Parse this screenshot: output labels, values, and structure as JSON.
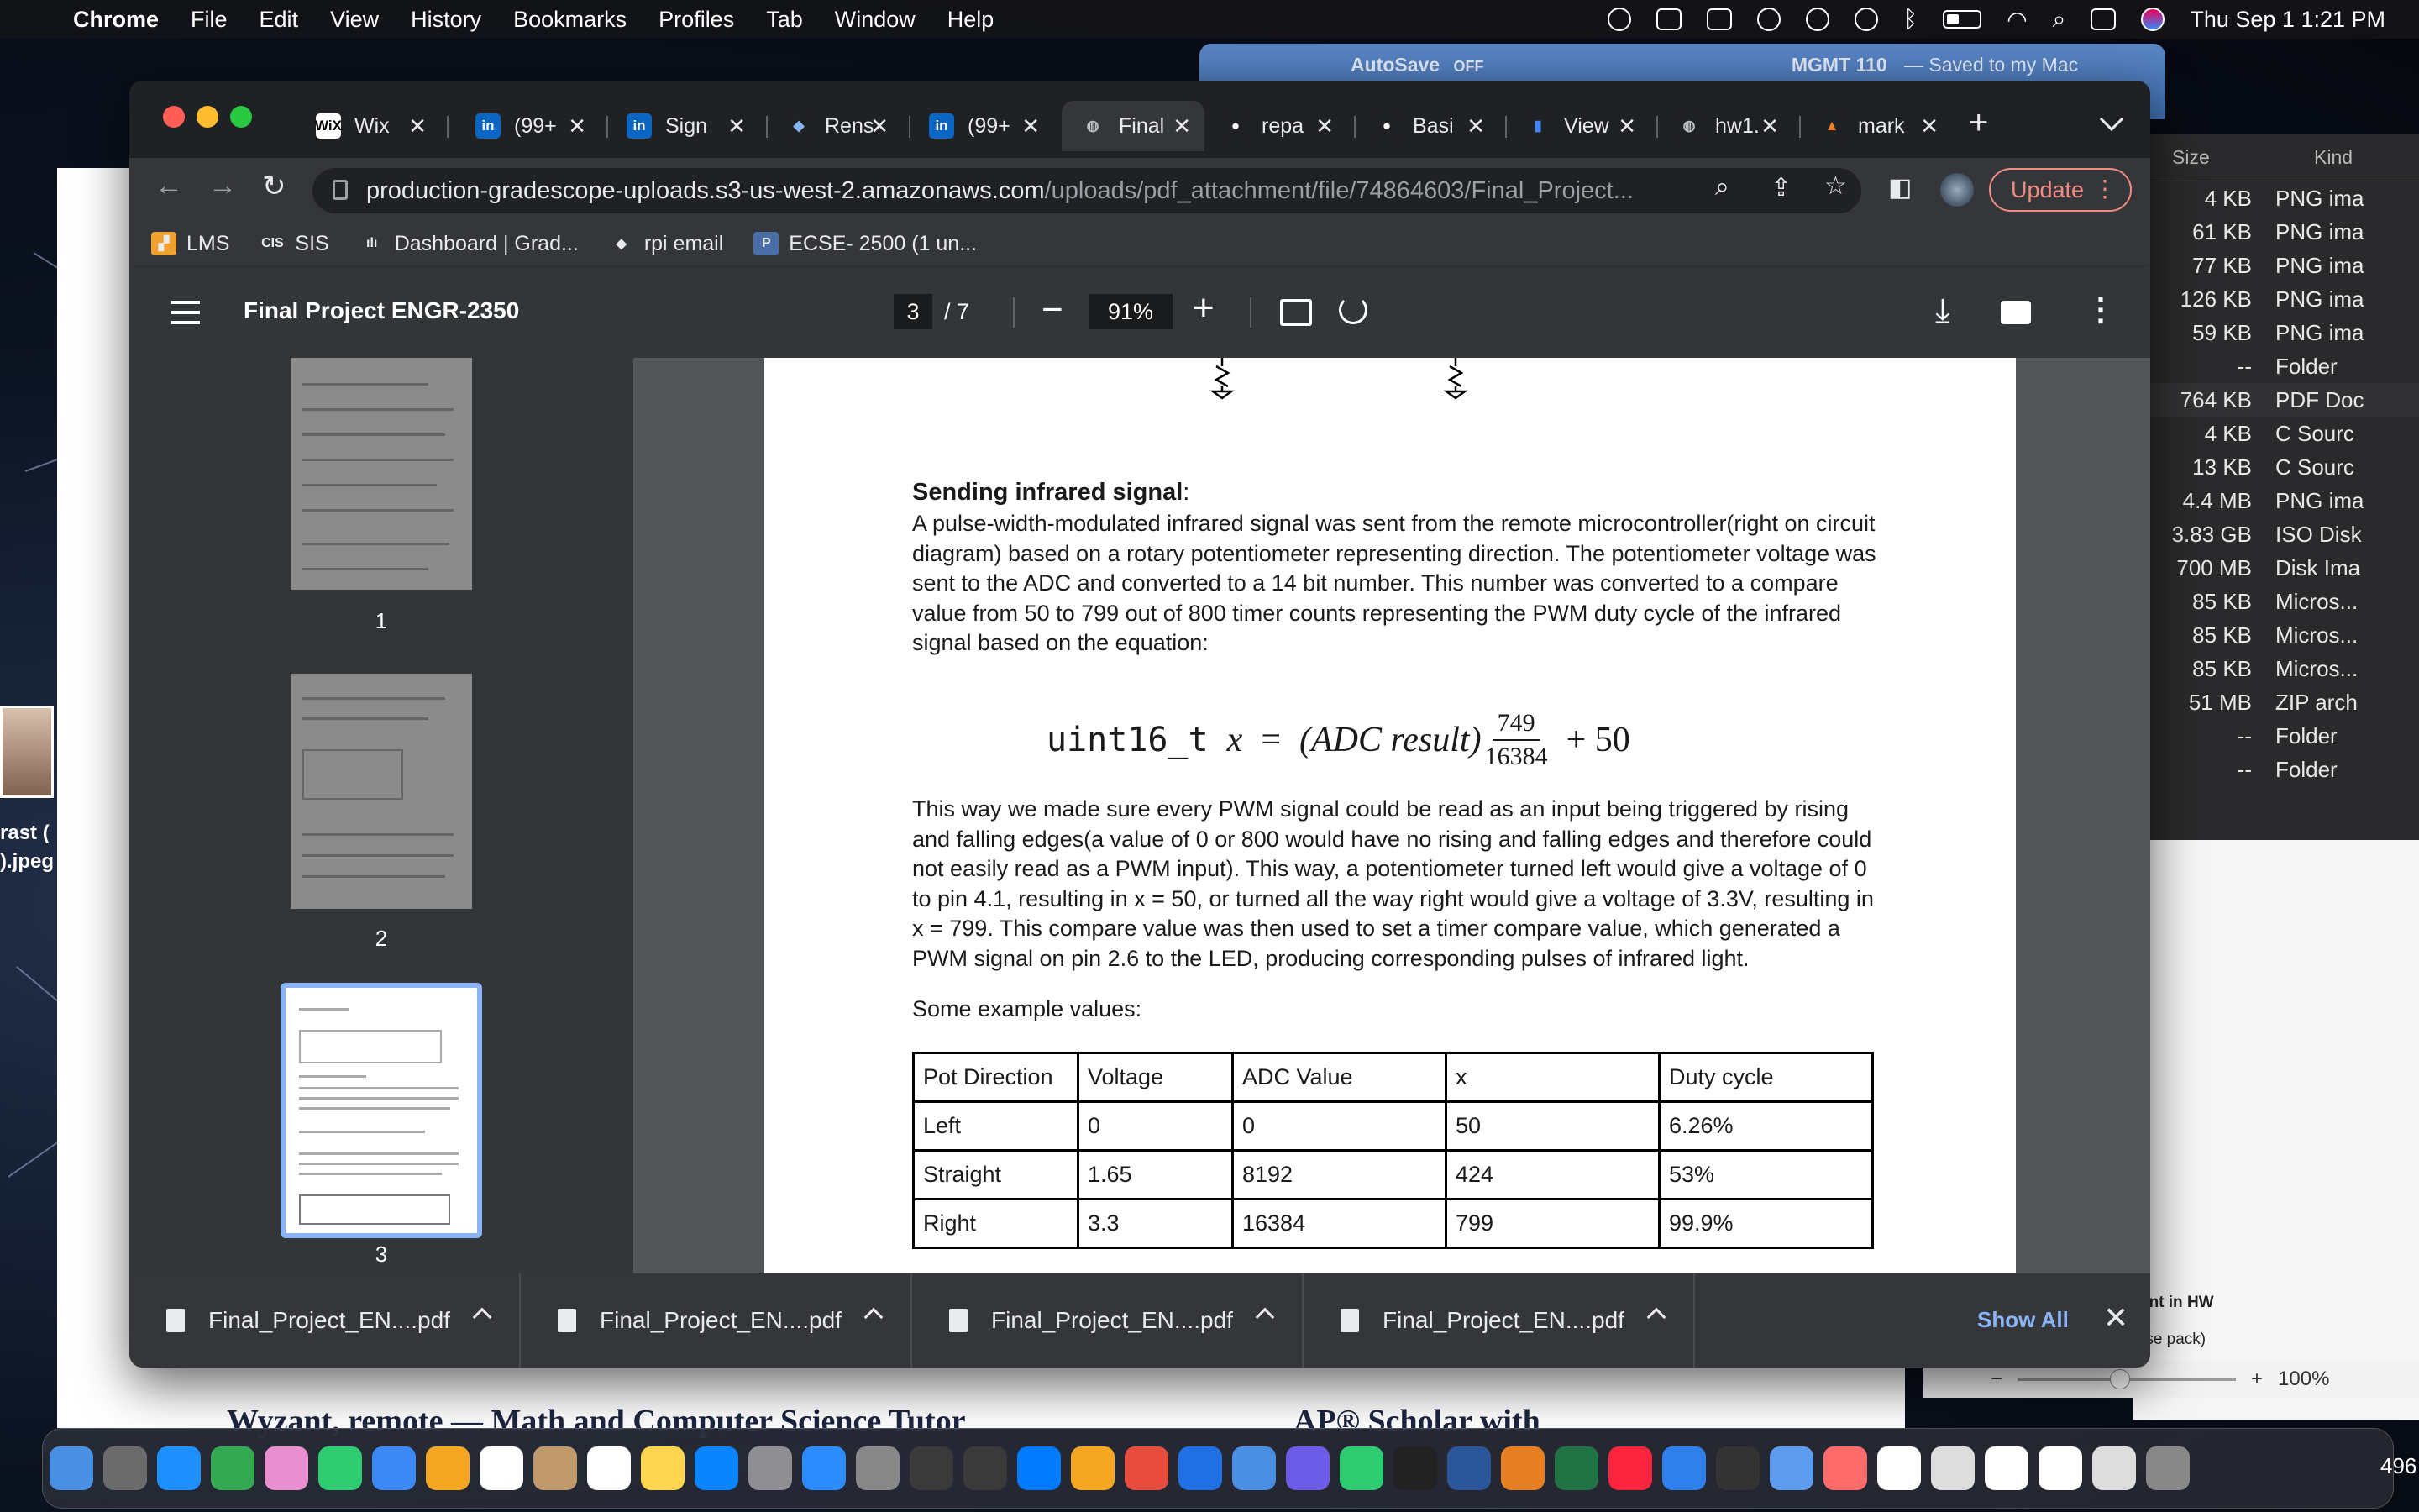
{
  "menubar": {
    "app": "Chrome",
    "items": [
      "File",
      "Edit",
      "View",
      "History",
      "Bookmarks",
      "Profiles",
      "Tab",
      "Window",
      "Help"
    ],
    "clock": "Thu Sep 1  1:21 PM"
  },
  "background": {
    "word_title": "AutoSave",
    "word_toggle": "OFF",
    "word_doc": "MGMT 110",
    "word_saved": "— Saved to my Mac",
    "desktop_file_label_1": "rast (",
    "desktop_file_label_2": ").jpeg",
    "doc_heading_left": "Wyzant, remote — Math and Computer Science Tutor",
    "doc_heading_right": "AP® Scholar with",
    "panel_text_1": "ent in HW",
    "panel_text_2": "rse pack)",
    "zoom_value": "100%",
    "dock_trailing": "496"
  },
  "finder": {
    "col_size": "Size",
    "col_kind": "Kind",
    "rows": [
      {
        "size": "4 KB",
        "kind": "PNG ima"
      },
      {
        "size": "61 KB",
        "kind": "PNG ima"
      },
      {
        "size": "77 KB",
        "kind": "PNG ima"
      },
      {
        "size": "126 KB",
        "kind": "PNG ima"
      },
      {
        "size": "59 KB",
        "kind": "PNG ima"
      },
      {
        "size": "--",
        "kind": "Folder"
      },
      {
        "size": "764 KB",
        "kind": "PDF Doc"
      },
      {
        "size": "4 KB",
        "kind": "C Sourc"
      },
      {
        "size": "13 KB",
        "kind": "C Sourc"
      },
      {
        "size": "4.4 MB",
        "kind": "PNG ima"
      },
      {
        "size": "3.83 GB",
        "kind": "ISO Disk"
      },
      {
        "size": "700 MB",
        "kind": "Disk Ima"
      },
      {
        "size": "85 KB",
        "kind": "Micros..."
      },
      {
        "size": "85 KB",
        "kind": "Micros..."
      },
      {
        "size": "85 KB",
        "kind": "Micros..."
      },
      {
        "size": "51 MB",
        "kind": "ZIP arch"
      },
      {
        "size": "--",
        "kind": "Folder"
      },
      {
        "size": "--",
        "kind": "Folder"
      }
    ]
  },
  "tabs": [
    {
      "label": "Wix",
      "fav": "WiX",
      "color": "#ffffff",
      "fg": "#000000"
    },
    {
      "label": "(99+",
      "fav": "in",
      "color": "#0a66c2",
      "fg": "#ffffff"
    },
    {
      "label": "Sign",
      "fav": "in",
      "color": "#0a66c2",
      "fg": "#ffffff"
    },
    {
      "label": "Rens",
      "fav": "◆",
      "color": "#202124",
      "fg": "#8ab4f8"
    },
    {
      "label": "(99+",
      "fav": "in",
      "color": "#0a66c2",
      "fg": "#ffffff"
    },
    {
      "label": "Final",
      "fav": "◍",
      "color": "#35363a",
      "fg": "#bdc1c6"
    },
    {
      "label": "repa",
      "fav": "●",
      "color": "#202124",
      "fg": "#ffffff"
    },
    {
      "label": "Basi",
      "fav": "●",
      "color": "#202124",
      "fg": "#ffffff"
    },
    {
      "label": "View",
      "fav": "▮",
      "color": "#202124",
      "fg": "#4285f4"
    },
    {
      "label": "hw1.",
      "fav": "◍",
      "color": "#202124",
      "fg": "#bdc1c6"
    },
    {
      "label": "mark",
      "fav": "▲",
      "color": "#202124",
      "fg": "#f6821f"
    }
  ],
  "omnibox": {
    "host": "production-gradescope-uploads.s3-us-west-2.amazonaws.com",
    "path": "/uploads/pdf_attachment/file/74864603/Final_Project...",
    "update_label": "Update"
  },
  "bookmarks": [
    {
      "label": "LMS",
      "fav": "▞",
      "bg": "#f0a030"
    },
    {
      "label": "SIS",
      "fav": "CIS",
      "bg": "#35363a"
    },
    {
      "label": "Dashboard | Grad...",
      "fav": "ılı",
      "bg": "#35363a"
    },
    {
      "label": "rpi email",
      "fav": "◆",
      "bg": "#35363a"
    },
    {
      "label": "ECSE- 2500 (1 un...",
      "fav": "P",
      "bg": "#4a6fa5"
    }
  ],
  "pdf": {
    "title": "Final Project ENGR-2350",
    "page_current": "3",
    "page_total": "/  7",
    "zoom": "91%",
    "thumb_numbers": [
      "1",
      "2",
      "3"
    ]
  },
  "document": {
    "section_title": "Sending infrared signal",
    "section_colon": ":",
    "para1": "A pulse-width-modulated infrared signal was sent from the remote microcontroller(right on circuit diagram) based on a rotary potentiometer representing direction. The potentiometer voltage was sent to the ADC and converted to a 14 bit number. This number was converted to a compare value from 50 to 799 out of 800 timer counts representing the PWM duty cycle of the infrared signal based on the equation:",
    "equation": {
      "type_decl": "uint16_t",
      "var": "x",
      "eq": "=",
      "lhs_paren": "(ADC result)",
      "numerator": "749",
      "denominator": "16384",
      "tail": "+ 50"
    },
    "para2": "This way we made sure every PWM signal could be read as an input being triggered by rising and falling edges(a value of 0 or 800 would have no rising and falling edges and therefore could not easily read as a PWM input). This way, a potentiometer turned left would give a voltage of 0 to pin 4.1, resulting in x = 50, or turned all the way right would give a voltage of 3.3V, resulting in x = 799. This compare value was then used to set a timer compare value, which generated a PWM signal on pin 2.6 to the LED, producing corresponding pulses of infrared light.",
    "examples_label": "Some example values:",
    "table": {
      "headers": [
        "Pot Direction",
        "Voltage",
        "ADC Value",
        "x",
        "Duty cycle"
      ],
      "rows": [
        [
          "Left",
          "0",
          "0",
          "50",
          "6.26%"
        ],
        [
          "Straight",
          "1.65",
          "8192",
          "424",
          "53%"
        ],
        [
          "Right",
          "3.3",
          "16384",
          "799",
          "99.9%"
        ]
      ]
    }
  },
  "downloads": {
    "items": [
      "Final_Project_EN....pdf",
      "Final_Project_EN....pdf",
      "Final_Project_EN....pdf",
      "Final_Project_EN....pdf"
    ],
    "show_all": "Show All"
  },
  "colors": {
    "accent": "#8ab4f8",
    "update": "#f28b82",
    "chrome_dark": "#202124",
    "chrome_mid": "#35363a"
  }
}
